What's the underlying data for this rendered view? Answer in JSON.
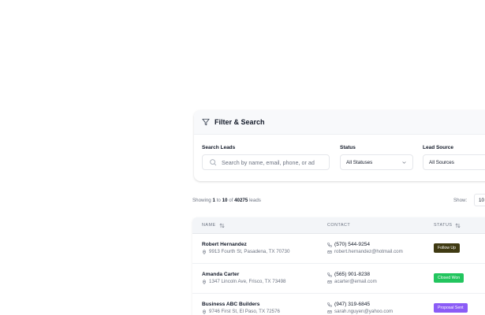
{
  "filter": {
    "title": "Filter & Search",
    "search_label": "Search Leads",
    "search_placeholder": "Search by name, email, phone, or ad",
    "status_label": "Status",
    "status_value": "All Statuses",
    "source_label": "Lead Source",
    "source_value": "All Sources"
  },
  "pagination": {
    "showing_prefix": "Showing",
    "from": "1",
    "to_word": "to",
    "to": "10",
    "of_word": "of",
    "total": "40275",
    "suffix": "leads",
    "show_label": "Show:",
    "show_value": "10"
  },
  "table": {
    "headers": {
      "name": "NAME",
      "contact": "CONTACT",
      "status": "STATUS"
    },
    "rows": [
      {
        "name": "Robert Hernandez",
        "address": "9913 Fourth St, Pasadena, TX 70730",
        "phone": "(570) 544-9254",
        "email": "robert.hernandez@hotmail.com",
        "status": "Follow Up",
        "status_color": "#3f3a12"
      },
      {
        "name": "Amanda Carter",
        "address": "1347 Lincoln Ave, Frisco, TX 73498",
        "phone": "(565) 901-8238",
        "email": "acarter@email.com",
        "status": "Closed Won",
        "status_color": "#22c55e"
      },
      {
        "name": "Business ABC Builders",
        "address": "9746 First St, El Paso, TX 72576",
        "phone": "(947) 319-6845",
        "email": "sarah.nguyen@yahoo.com",
        "status": "Proposal Sent",
        "status_color": "#8b5cf6"
      }
    ]
  },
  "icons": {
    "filter": "filter-icon",
    "search": "search-icon",
    "chevron": "chevron-down-icon",
    "sort": "sort-icon",
    "pin": "map-pin-icon",
    "phone": "phone-icon",
    "mail": "mail-icon"
  }
}
